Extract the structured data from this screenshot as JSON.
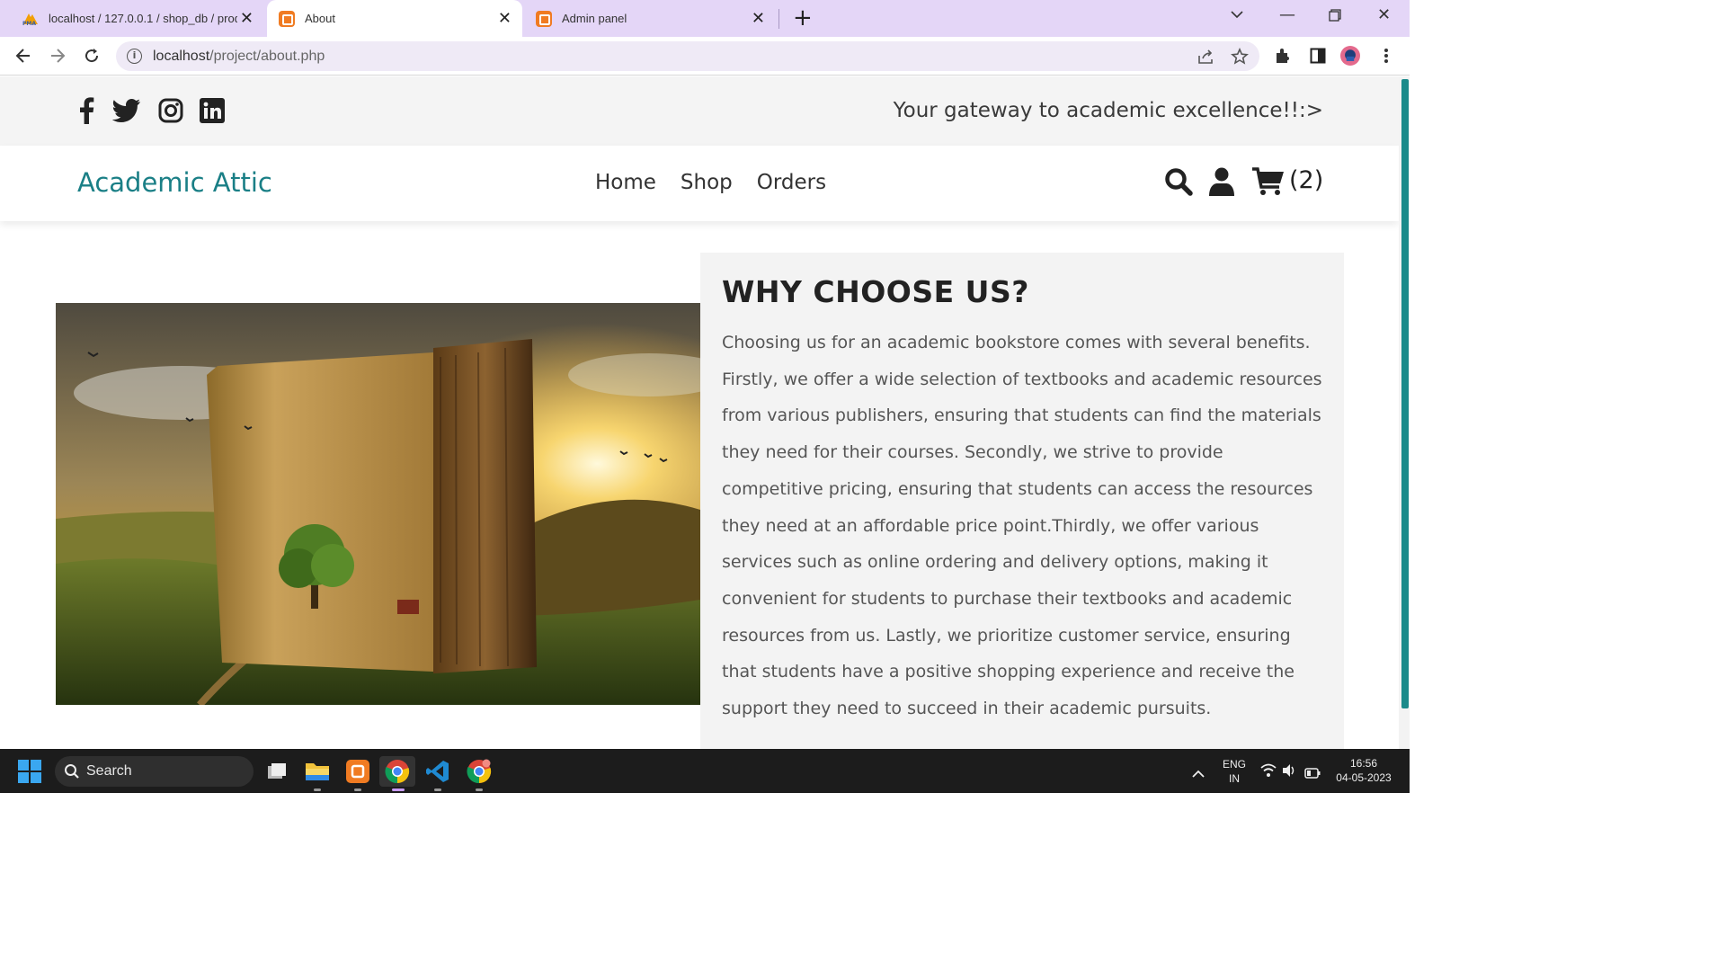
{
  "browser": {
    "tabs": [
      {
        "title": "localhost / 127.0.0.1 / shop_db / produc",
        "active": false,
        "favicon": "phpmyadmin-icon"
      },
      {
        "title": "About",
        "active": true,
        "favicon": "xampp-icon"
      },
      {
        "title": "Admin panel",
        "active": false,
        "favicon": "xampp-icon"
      }
    ],
    "url_host": "localhost",
    "url_path": "/project/about.php",
    "accent": "#e4d6f7"
  },
  "topbar": {
    "social_icons": [
      "facebook-icon",
      "twitter-icon",
      "instagram-icon",
      "linkedin-icon"
    ],
    "tagline": "Your gateway to academic excellence!!:>"
  },
  "header": {
    "logo": "Academic Attic",
    "nav": [
      "Home",
      "Shop",
      "Orders"
    ],
    "cart_count": "(2)",
    "brand_color": "#1a7f86"
  },
  "about": {
    "heading": "WHY CHOOSE US?",
    "body": "Choosing us for an academic bookstore comes with several benefits. Firstly, we offer a wide selection of textbooks and academic resources from various publishers, ensuring that students can find the materials they need for their courses. Secondly, we strive to provide competitive pricing, ensuring that students can access the resources they need at an affordable price point.Thirdly, we offer various services such as online ordering and delivery options, making it convenient for students to purchase their textbooks and academic resources from us. Lastly, we prioritize customer service, ensuring that students have a positive shopping experience and receive the support they need to succeed in their academic pursuits."
  },
  "taskbar": {
    "search_label": "Search",
    "language": "ENG",
    "region": "IN",
    "time": "16:56",
    "date": "04-05-2023"
  }
}
